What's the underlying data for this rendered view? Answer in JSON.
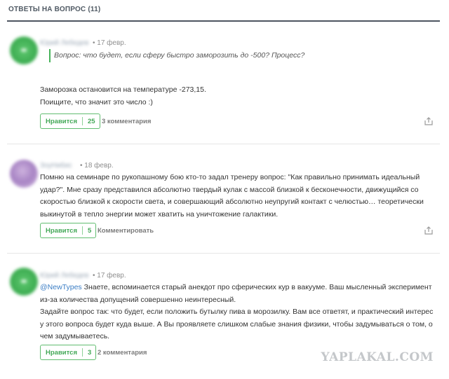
{
  "section": {
    "title": "ОТВЕТЫ НА ВОПРОС (11)"
  },
  "comments": [
    {
      "author": "Юрий Лебедев",
      "date": "• 17 февр.",
      "quote": "Вопрос: что будет, если сферу быстро заморозить до -500? Процесс?",
      "lines": [
        "Заморозка остановится на температуре -273,15.",
        "Поищите, что значит это число :)"
      ],
      "like_label": "Нравится",
      "like_count": "25",
      "comments_label": "3 комментария"
    },
    {
      "author": "ЗоуНибис",
      "date": "• 18 февр.",
      "text": "Помню на семинаре по рукопашному бою кто-то задал тренеру вопрос: \"Как правильно принимать идеальный удар?\". Мне сразу представился абсолютно твердый кулак с массой близкой к бесконечности, движущийся со скоростью близкой к скорости света, и совершающий абсолютно неупругий контакт с челюстью… теоретически выкинутой в тепло энергии может хватить на уничтожение галактики.",
      "like_label": "Нравится",
      "like_count": "5",
      "comments_label": "Комментировать"
    },
    {
      "author": "Юрий Лебедев",
      "date": "• 17 февр.",
      "mention": "@NewTypes",
      "text_after_mention": " Знаете, вспоминается старый анекдот про сферических кур в вакууме. Ваш мысленный эксперимент из-за количества допущений совершенно неинтересный.",
      "text2": "Задайте вопрос так: что будет, если положить бутылку пива в морозилку. Вам все ответят, и практический интерес у этого вопроса будет куда выше. А Вы проявляете слишком слабые знания физики, чтобы задумываться о том, о чем задумываетесь.",
      "like_label": "Нравится",
      "like_count": "3",
      "comments_label": "2 комментария"
    }
  ],
  "watermark": "YAPLAKAL.COM",
  "colors": {
    "accent_green": "#47b35a",
    "mention_blue": "#3a7dc4",
    "header_line": "#4d5560"
  },
  "icons": [
    "share-icon"
  ]
}
